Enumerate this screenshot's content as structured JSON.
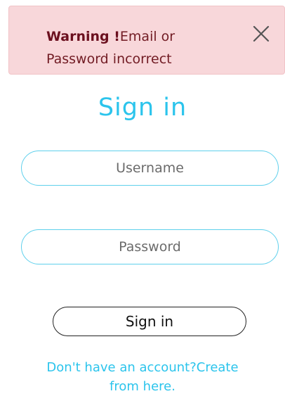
{
  "alert": {
    "strong": "Warning !",
    "message": "Email or Password incorrect",
    "close_icon": "close-icon"
  },
  "form": {
    "title": "Sign in",
    "username_placeholder": "Username",
    "password_placeholder": "Password",
    "submit_label": "Sign in"
  },
  "footer": {
    "prompt": "Don't have an account?",
    "link_line1": "Create",
    "link_line2": "from here."
  },
  "colors": {
    "accent": "#2bc4ec",
    "alert_background": "#f8d7da",
    "alert_text": "#721c24"
  }
}
